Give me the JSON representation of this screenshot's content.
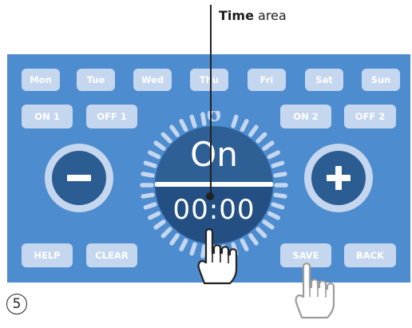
{
  "callout": {
    "bold": "Time",
    "rest": " area"
  },
  "days": [
    {
      "label": "Mon",
      "key": "mon"
    },
    {
      "label": "Tue",
      "key": "tue"
    },
    {
      "label": "Wed",
      "key": "wed"
    },
    {
      "label": "Thu",
      "key": "thu"
    },
    {
      "label": "Fri",
      "key": "fri"
    },
    {
      "label": "Sat",
      "key": "sat"
    },
    {
      "label": "Sun",
      "key": "sun"
    }
  ],
  "periods": {
    "on1": "ON 1",
    "off1": "OFF 1",
    "on2": "ON 2",
    "off2": "OFF 2"
  },
  "display": {
    "mode": "On",
    "time": "00:00"
  },
  "actions": {
    "help": "HELP",
    "clear": "CLEAR",
    "save": "SAVE",
    "back": "BACK"
  },
  "step_number": "5",
  "icons": {
    "minus": "minus-icon",
    "plus": "plus-icon",
    "flame": "flame-icon",
    "hand": "pointing-hand-icon"
  },
  "colors": {
    "panel": "#4d8ccf",
    "button": "#c5d6ef",
    "dial_dark": "#2e5f95",
    "dial_lower": "#234f82",
    "round_button": "#2b5c92"
  }
}
